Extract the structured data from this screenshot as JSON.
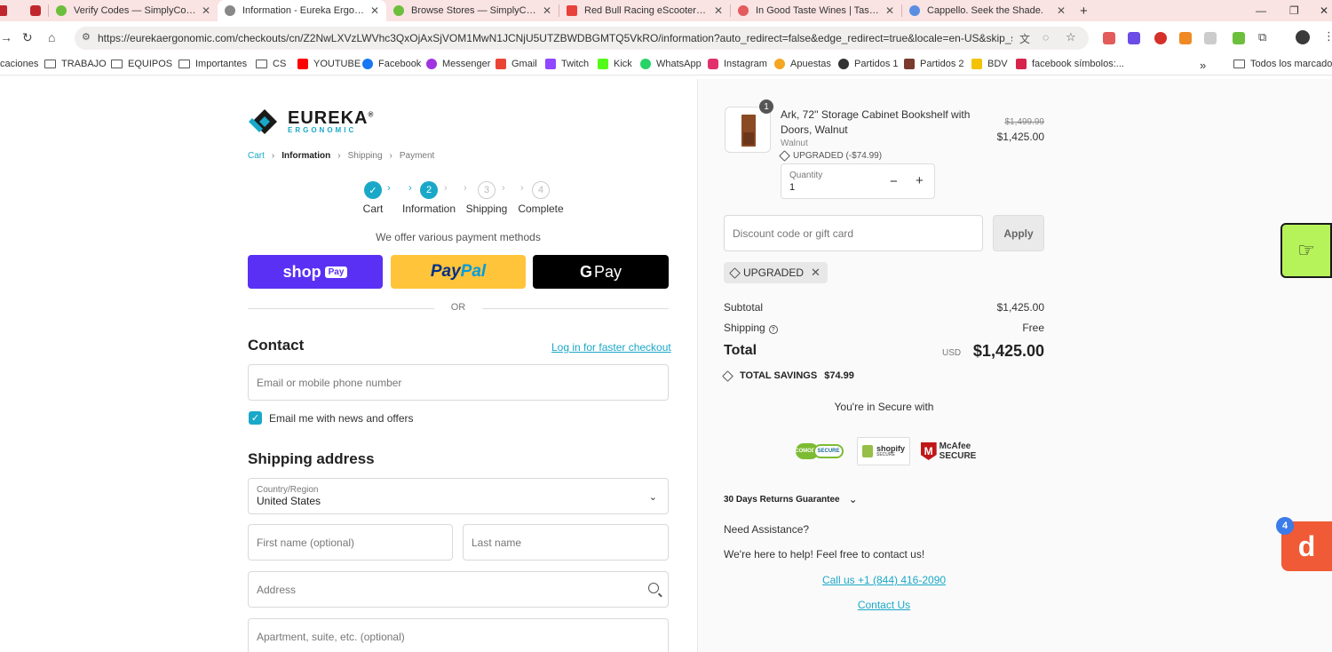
{
  "browser": {
    "tabs": [
      {
        "label": "",
        "color": "#c0272d"
      },
      {
        "label": "Verify Codes — SimplyCodes",
        "color": "#6cbf3c"
      },
      {
        "label": "Information - Eureka Ergonomic",
        "color": "#888888"
      },
      {
        "label": "Browse Stores — SimplyCodes",
        "color": "#6cbf3c"
      },
      {
        "label": "Red Bull Racing eScooter – Ora",
        "color": "#e7413a"
      },
      {
        "label": "In Good Taste Wines | Tasting F",
        "color": "#e35b5b"
      },
      {
        "label": "Cappello. Seek the Shade.",
        "color": "#5b8de3"
      }
    ],
    "new_tab": "+",
    "url": "https://eurekaergonomic.com/checkouts/cn/Z2NwLXVzLWVhc3QxOjAxSjVOM1MwN1JCNjU5UTZBWDBGMTQ5VkRO/information?auto_redirect=false&edge_redirect=true&locale=en-US&skip_shop_pay...",
    "bookmarks": [
      {
        "label": "caciones",
        "type": "none"
      },
      {
        "label": "TRABAJO",
        "type": "folder"
      },
      {
        "label": "EQUIPOS",
        "type": "folder"
      },
      {
        "label": "Importantes",
        "type": "folder"
      },
      {
        "label": "CS",
        "type": "folder"
      },
      {
        "label": "YOUTUBE",
        "type": "icon",
        "color": "#ff0000"
      },
      {
        "label": "Facebook",
        "type": "icon",
        "color": "#1877f2"
      },
      {
        "label": "Messenger",
        "type": "icon",
        "color": "#a034e0"
      },
      {
        "label": "Gmail",
        "type": "icon",
        "color": "#ea4335"
      },
      {
        "label": "Twitch",
        "type": "icon",
        "color": "#9146ff"
      },
      {
        "label": "Kick",
        "type": "icon",
        "color": "#53fc18"
      },
      {
        "label": "WhatsApp",
        "type": "icon",
        "color": "#25d366"
      },
      {
        "label": "Instagram",
        "type": "icon",
        "color": "#e1306c"
      },
      {
        "label": "Apuestas",
        "type": "icon",
        "color": "#f5a623"
      },
      {
        "label": "Partidos 1",
        "type": "icon",
        "color": "#333333"
      },
      {
        "label": "Partidos 2",
        "type": "icon",
        "color": "#7a3b2e"
      },
      {
        "label": "BDV",
        "type": "icon",
        "color": "#f3c300"
      },
      {
        "label": "facebook símbolos:...",
        "type": "icon",
        "color": "#d6244b"
      }
    ],
    "more_bookmarks": "»",
    "all_bookmarks": "Todos los marcadores"
  },
  "brand": {
    "name": "EUREKA",
    "sub": "ERGONOMIC",
    "reg": "®",
    "accent": "#1aa8c8"
  },
  "breadcrumb": {
    "cart": "Cart",
    "information": "Information",
    "shipping": "Shipping",
    "payment": "Payment"
  },
  "steps": [
    {
      "label": "Cart",
      "num": "✓",
      "state": "done"
    },
    {
      "label": "Information",
      "num": "2",
      "state": "cur"
    },
    {
      "label": "Shipping",
      "num": "3",
      "state": "todo"
    },
    {
      "label": "Complete",
      "num": "4",
      "state": "todo"
    }
  ],
  "payments": {
    "note": "We offer various payment methods",
    "shop": "shop",
    "shop_tag": "Pay",
    "paypal_1": "Pay",
    "paypal_2": "Pal",
    "gpay_g": "G",
    "gpay": "Pay",
    "or": "OR"
  },
  "contact": {
    "heading": "Contact",
    "login": "Log in for faster checkout",
    "email_placeholder": "Email or mobile phone number",
    "newsletter": "Email me with news and offers",
    "newsletter_checked": true
  },
  "shipping": {
    "heading": "Shipping address",
    "country_label": "Country/Region",
    "country": "United States",
    "first_name": "First name (optional)",
    "last_name": "Last name",
    "address": "Address",
    "apartment": "Apartment, suite, etc. (optional)"
  },
  "order": {
    "qty_badge": "1",
    "product": "Ark, 72'' Storage Cabinet Bookshelf with Doors, Walnut",
    "variant": "Walnut",
    "discount_tag": "UPGRADED (-$74.99)",
    "price_old": "$1,499.99",
    "price_new": "$1,425.00",
    "quantity_label": "Quantity",
    "quantity": "1",
    "discount_placeholder": "Discount code or gift card",
    "apply": "Apply",
    "code": "UPGRADED",
    "subtotal_label": "Subtotal",
    "subtotal": "$1,425.00",
    "shipping_label": "Shipping",
    "shipping": "Free",
    "total_label": "Total",
    "currency": "USD",
    "total": "$1,425.00",
    "savings_label": "TOTAL SAVINGS",
    "savings": "$74.99",
    "secure": "You're in Secure with",
    "comodo_1": "COMODO",
    "comodo_2": "SECURE",
    "shopify_1": "shopify",
    "shopify_2": "SECURE",
    "mcafee_m": "M",
    "mcafee_1": "McAfee",
    "mcafee_2": "SECURE",
    "returns": "30 Days Returns Guarantee",
    "need": "Need Assistance?",
    "help": "We're here to help! Feel free to contact us!",
    "call": "Call us +1 (844) 416-2090",
    "contact_us": "Contact Us"
  },
  "widgets": {
    "orange_letter": "d",
    "orange_count": "4"
  }
}
